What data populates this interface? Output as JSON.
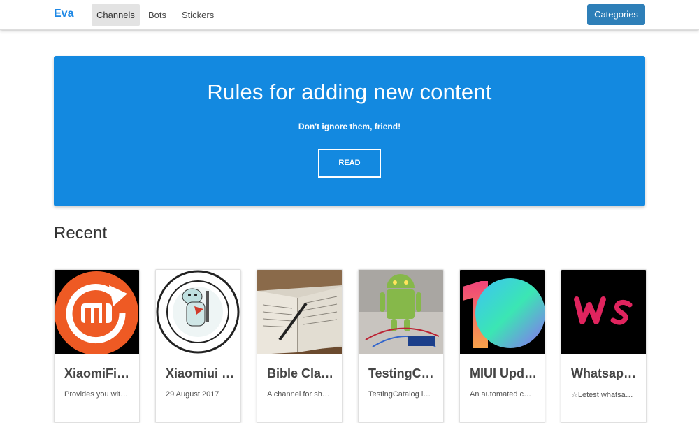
{
  "nav": {
    "brand": "Eva",
    "items": [
      {
        "label": "Channels",
        "active": true
      },
      {
        "label": "Bots",
        "active": false
      },
      {
        "label": "Stickers",
        "active": false
      }
    ],
    "categories_label": "Categories"
  },
  "hero": {
    "title": "Rules for adding new content",
    "subtitle": "Don't ignore them, friend!",
    "button_label": "READ",
    "background": "#1389e0"
  },
  "recent": {
    "heading": "Recent",
    "cards": [
      {
        "title": "XiaomiFir…",
        "description": "Provides you wit…",
        "image": "mi-logo"
      },
      {
        "title": "Xiaomiui …",
        "description": "29 August 2017",
        "image": "xiaomiui-seal"
      },
      {
        "title": "Bible Cla…",
        "description": "A channel for sh…",
        "image": "open-bible-photo"
      },
      {
        "title": "TestingC…",
        "description": "TestingCatalog i…",
        "image": "android-robot-photo"
      },
      {
        "title": "MIUI Upd…",
        "description": "An automated ch…",
        "image": "miui-10-logo"
      },
      {
        "title": "Whatsap…",
        "description": "☆Letest whatsa…",
        "image": "ws-logo"
      }
    ]
  },
  "colors": {
    "brand": "#1e88e5",
    "categories_button": "#2e7fb8"
  }
}
